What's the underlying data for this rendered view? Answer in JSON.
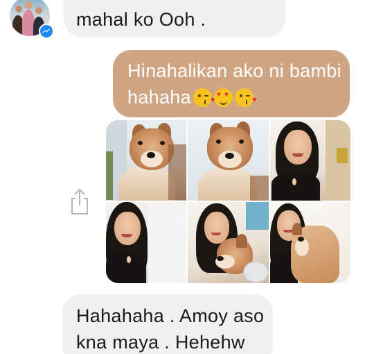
{
  "thread": {
    "incoming_top": {
      "line2": "mahal ko Ooh ."
    },
    "outgoing": {
      "line1": "Hinahalikan ako ni bambi",
      "line2": "hahaha",
      "emojis": [
        "kissing-face-with-heart",
        "heart-eyes-face",
        "kissing-face-with-heart"
      ]
    },
    "photos": [
      {
        "subject": "dog"
      },
      {
        "subject": "dog"
      },
      {
        "subject": "girl-selfie"
      },
      {
        "subject": "girl-selfie"
      },
      {
        "subject": "girl-with-dog"
      },
      {
        "subject": "girl-with-dog"
      }
    ],
    "incoming_reply": {
      "line1": "Hahahaha . Amoy aso",
      "line2": "kna maya . Hehehw"
    }
  },
  "colors": {
    "incoming_bubble": "#f0f0f0",
    "outgoing_bubble": "#cfa584",
    "messenger_blue": "#1e88f5"
  },
  "icons": {
    "share": "share-icon",
    "badge": "messenger-icon"
  }
}
